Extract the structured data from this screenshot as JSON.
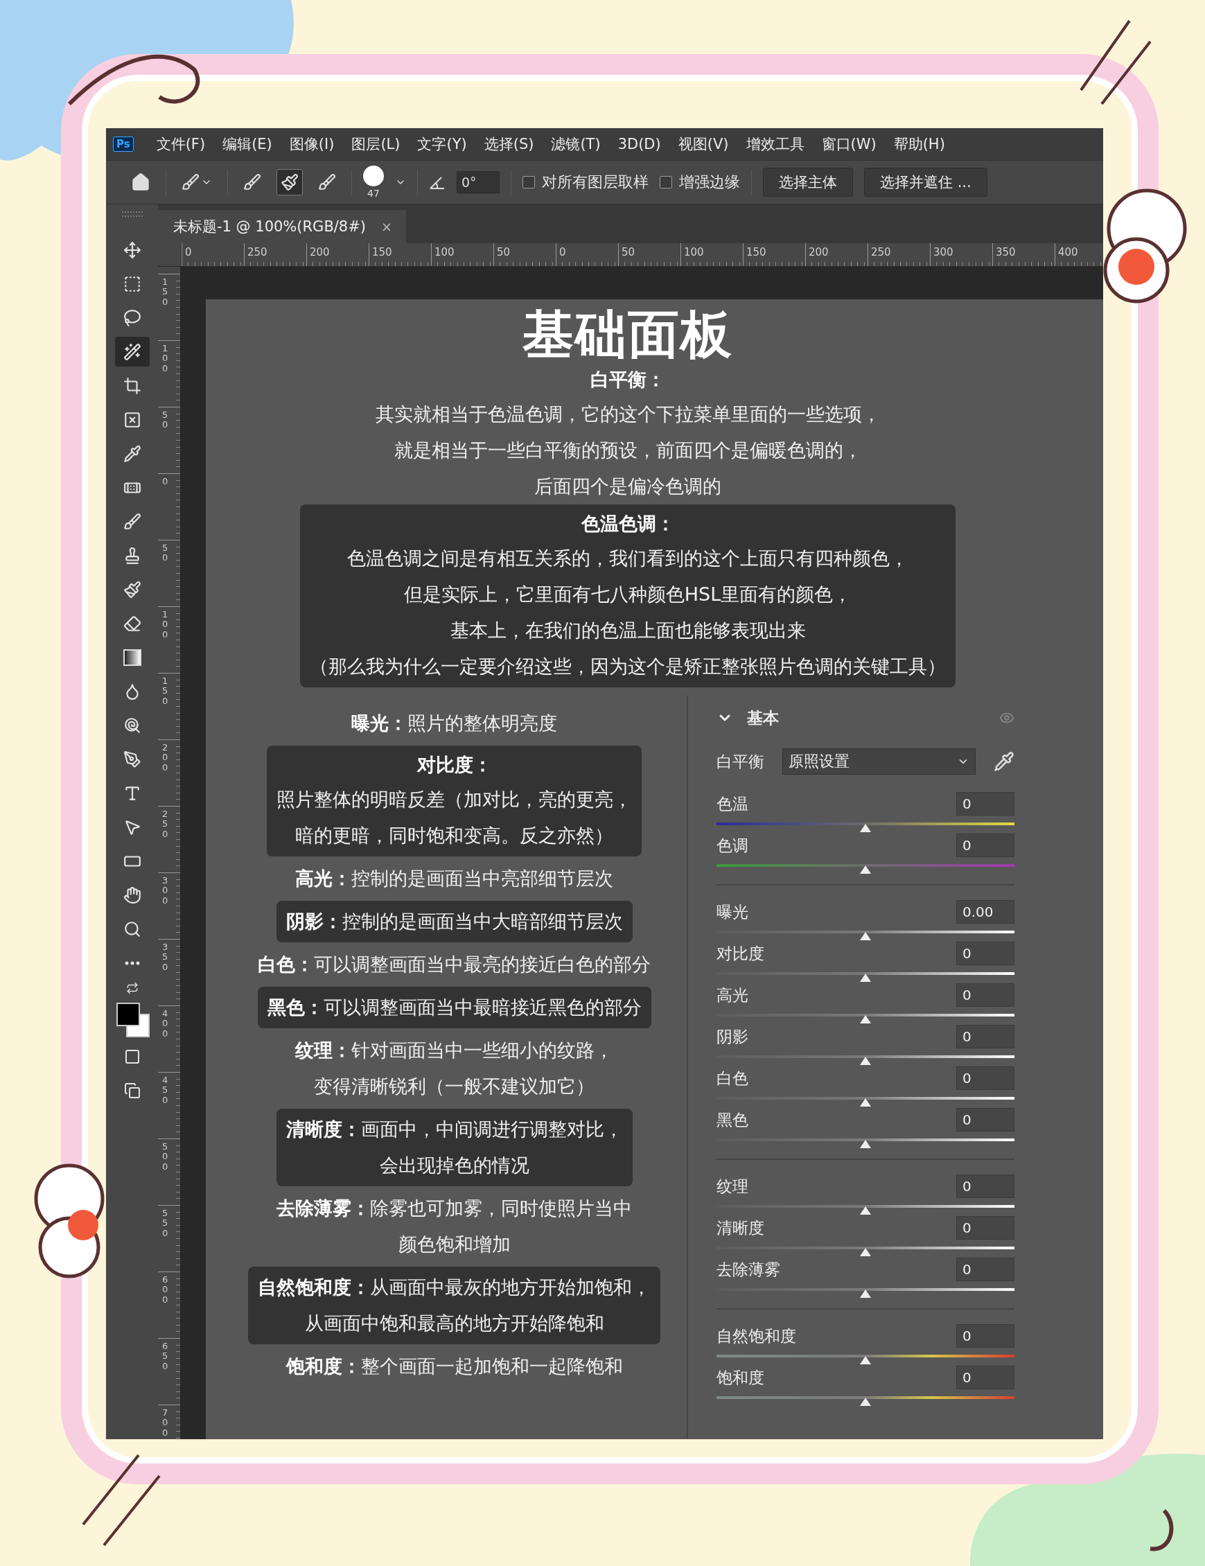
{
  "app_logo": "Ps",
  "menu": [
    "文件(F)",
    "编辑(E)",
    "图像(I)",
    "图层(L)",
    "文字(Y)",
    "选择(S)",
    "滤镜(T)",
    "3D(D)",
    "视图(V)",
    "增效工具",
    "窗口(W)",
    "帮助(H)"
  ],
  "options_bar": {
    "selection_modes": [
      {
        "kind": "new",
        "selected": false
      },
      {
        "kind": "add",
        "selected": true
      },
      {
        "kind": "subtract",
        "selected": false
      }
    ],
    "brush_size": "47",
    "angle": "0°",
    "checkboxes": [
      {
        "label": "对所有图层取样",
        "checked": false
      },
      {
        "label": "增强边缘",
        "checked": false
      }
    ],
    "buttons": [
      "选择主体",
      "选择并遮住 ..."
    ]
  },
  "document_tab": {
    "title": "未标题-1 @ 100%(RGB/8#)",
    "close": "×"
  },
  "tools": [
    {
      "kind": "move",
      "selected": false
    },
    {
      "kind": "marquee",
      "selected": false
    },
    {
      "kind": "lasso",
      "selected": false
    },
    {
      "kind": "quick-select",
      "selected": true
    },
    {
      "kind": "crop",
      "selected": false
    },
    {
      "kind": "frame",
      "selected": false
    },
    {
      "kind": "eyedropper",
      "selected": false
    },
    {
      "kind": "healing",
      "selected": false
    },
    {
      "kind": "brush",
      "selected": false
    },
    {
      "kind": "stamp",
      "selected": false
    },
    {
      "kind": "history-brush",
      "selected": false
    },
    {
      "kind": "eraser",
      "selected": false
    },
    {
      "kind": "gradient",
      "selected": false
    },
    {
      "kind": "blur",
      "selected": false
    },
    {
      "kind": "dodge",
      "selected": false
    },
    {
      "kind": "pen",
      "selected": false
    },
    {
      "kind": "type",
      "selected": false
    },
    {
      "kind": "path-select",
      "selected": false
    },
    {
      "kind": "rectangle",
      "selected": false
    },
    {
      "kind": "hand",
      "selected": false
    },
    {
      "kind": "zoom",
      "selected": false
    },
    {
      "kind": "more",
      "selected": false
    }
  ],
  "ruler": {
    "horizontal": [
      "0",
      "250",
      "200",
      "150",
      "100",
      "50",
      "0",
      "50",
      "100",
      "150",
      "200",
      "250",
      "300",
      "350",
      "400"
    ],
    "vertical": [
      "150",
      "100",
      "50",
      "0",
      "50",
      "100",
      "150",
      "200",
      "250",
      "300",
      "350",
      "400",
      "450",
      "500",
      "550",
      "600",
      "650",
      "700"
    ]
  },
  "document": {
    "title": "基础面板",
    "top_sections": [
      {
        "boxed": false,
        "heading": "白平衡：",
        "lines": [
          "其实就相当于色温色调，它的这个下拉菜单里面的一些选项，",
          "就是相当于一些白平衡的预设，前面四个是偏暖色调的，",
          "后面四个是偏冷色调的"
        ]
      },
      {
        "boxed": true,
        "heading": "色温色调：",
        "lines": [
          "色温色调之间是有相互关系的，我们看到的这个上面只有四种颜色，",
          "但是实际上，它里面有七八种颜色HSL里面有的颜色，",
          "基本上，在我们的色温上面也能够表现出来",
          "（那么我为什么一定要介绍这些，因为这个是矫正整张照片色调的关键工具）"
        ]
      }
    ],
    "left_sections": [
      {
        "boxed": false,
        "lines": [
          "**曝光：**照片的整体明亮度"
        ]
      },
      {
        "boxed": true,
        "heading": "对比度：",
        "lines": [
          "照片整体的明暗反差（加对比，亮的更亮，",
          "暗的更暗，同时饱和变高。反之亦然）"
        ]
      },
      {
        "boxed": false,
        "lines": [
          "**高光：**控制的是画面当中亮部细节层次"
        ]
      },
      {
        "boxed": true,
        "lines": [
          "**阴影：**控制的是画面当中大暗部细节层次"
        ]
      },
      {
        "boxed": false,
        "lines": [
          "**白色：**可以调整画面当中最亮的接近白色的部分"
        ]
      },
      {
        "boxed": true,
        "lines": [
          "**黑色：**可以调整画面当中最暗接近黑色的部分"
        ]
      },
      {
        "boxed": false,
        "lines": [
          "**纹理：**针对画面当中一些细小的纹路，",
          "变得清晰锐利（一般不建议加它）"
        ]
      },
      {
        "boxed": true,
        "lines": [
          "**清晰度：**画面中，中间调进行调整对比，",
          "会出现掉色的情况"
        ]
      },
      {
        "boxed": false,
        "lines": [
          "**去除薄雾：**除雾也可加雾，同时使照片当中",
          "颜色饱和增加"
        ]
      },
      {
        "boxed": true,
        "lines": [
          "**自然饱和度：**从画面中最灰的地方开始加饱和，",
          "从画面中饱和最高的地方开始降饱和"
        ]
      },
      {
        "boxed": false,
        "lines": [
          "**饱和度：**整个画面一起加饱和一起降饱和"
        ]
      }
    ]
  },
  "basic_panel": {
    "title": "基本",
    "expanded": true,
    "white_balance": {
      "label": "白平衡",
      "value": "原照设置"
    },
    "groups": [
      [
        {
          "label": "色温",
          "value": "0",
          "level": 0.5,
          "kind": "temperature"
        },
        {
          "label": "色调",
          "value": "0",
          "level": 0.5,
          "kind": "tint"
        }
      ],
      [
        {
          "label": "曝光",
          "value": "0.00",
          "level": 0.5,
          "kind": "tone"
        },
        {
          "label": "对比度",
          "value": "0",
          "level": 0.5,
          "kind": "tone"
        },
        {
          "label": "高光",
          "value": "0",
          "level": 0.5,
          "kind": "tone"
        },
        {
          "label": "阴影",
          "value": "0",
          "level": 0.5,
          "kind": "tone"
        },
        {
          "label": "白色",
          "value": "0",
          "level": 0.5,
          "kind": "tone"
        },
        {
          "label": "黑色",
          "value": "0",
          "level": 0.5,
          "kind": "tone"
        }
      ],
      [
        {
          "label": "纹理",
          "value": "0",
          "level": 0.5,
          "kind": "tone"
        },
        {
          "label": "清晰度",
          "value": "0",
          "level": 0.5,
          "kind": "tone"
        },
        {
          "label": "去除薄雾",
          "value": "0",
          "level": 0.5,
          "kind": "tone"
        }
      ],
      [
        {
          "label": "自然饱和度",
          "value": "0",
          "level": 0.5,
          "kind": "saturation"
        },
        {
          "label": "饱和度",
          "value": "0",
          "level": 0.5,
          "kind": "saturation"
        }
      ]
    ]
  }
}
